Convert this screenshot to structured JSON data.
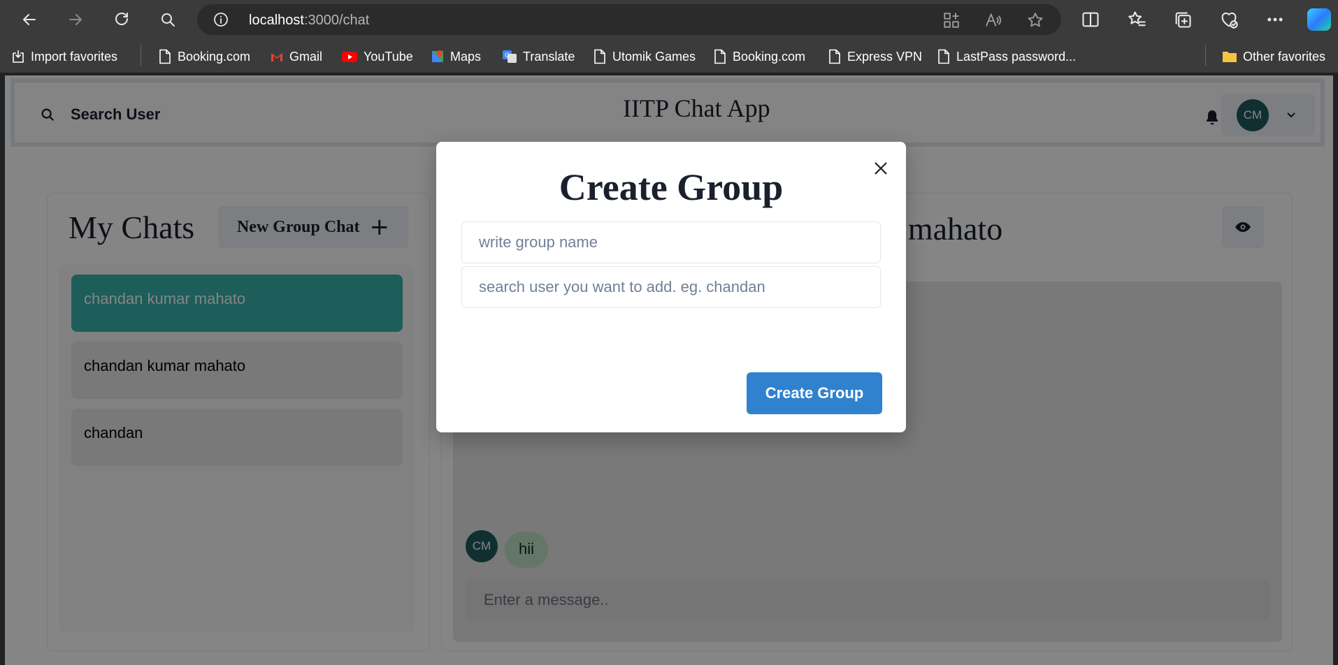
{
  "browser": {
    "address": {
      "host": "localhost",
      "path": ":3000/chat"
    },
    "bookmarks": [
      {
        "label": "Import favorites",
        "icon": "import-icon"
      },
      {
        "label": "Booking.com",
        "icon": "page-icon"
      },
      {
        "label": "Gmail",
        "icon": "gmail-icon"
      },
      {
        "label": "YouTube",
        "icon": "youtube-icon"
      },
      {
        "label": "Maps",
        "icon": "maps-icon"
      },
      {
        "label": "Translate",
        "icon": "translate-icon"
      },
      {
        "label": "Utomik Games",
        "icon": "page-icon"
      },
      {
        "label": "Booking.com",
        "icon": "page-icon"
      },
      {
        "label": "Express VPN",
        "icon": "page-icon"
      },
      {
        "label": "LastPass password...",
        "icon": "page-icon"
      }
    ],
    "other_favorites": "Other favorites"
  },
  "app": {
    "header": {
      "search_label": "Search User",
      "title": "IITP Chat App",
      "avatar_initials": "CM"
    },
    "mychats": {
      "title": "My Chats",
      "new_group_label": "New Group Chat",
      "items": [
        {
          "name": "chandan kumar mahato",
          "active": true
        },
        {
          "name": "chandan kumar mahato",
          "active": false
        },
        {
          "name": "chandan",
          "active": false
        }
      ]
    },
    "chatbox": {
      "heading": "r mahato",
      "messages": [
        {
          "avatar_initials": "CM",
          "text": "hii"
        }
      ],
      "input_placeholder": "Enter a message.."
    }
  },
  "modal": {
    "title": "Create Group",
    "group_name_placeholder": "write group name",
    "search_placeholder": "search user you want to add. eg. chandan",
    "submit_label": "Create Group"
  },
  "colors": {
    "active_chat": "#38b2ac",
    "primary_button": "#3182ce",
    "avatar": "#1f5a5e",
    "message_bubble": "#bee3c8"
  }
}
